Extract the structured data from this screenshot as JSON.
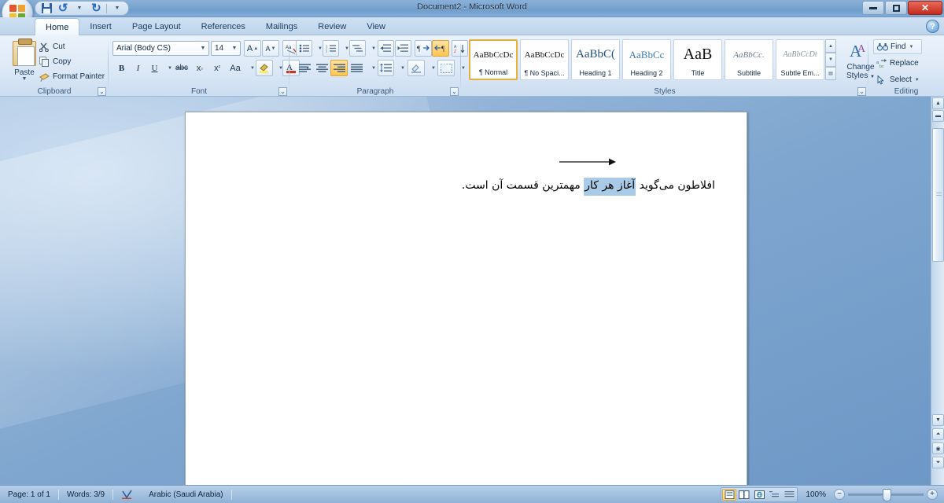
{
  "window": {
    "title": "Document2 - Microsoft Word",
    "minimize_label": "Minimize",
    "restore_label": "Restore",
    "close_label": "Close",
    "help_label": "?"
  },
  "quick_access": {
    "office_button": "office-button",
    "items": [
      {
        "name": "save-button",
        "icon": "save-icon",
        "label": "Save"
      },
      {
        "name": "undo-button",
        "icon": "undo-icon",
        "label": "Undo"
      },
      {
        "name": "redo-button",
        "icon": "redo-icon",
        "label": "Redo"
      },
      {
        "name": "customize-qat-button",
        "icon": "chevron-down-icon",
        "label": "Customize Quick Access Toolbar"
      }
    ]
  },
  "ribbon": {
    "tabs": [
      {
        "label": "Home",
        "active": true
      },
      {
        "label": "Insert",
        "active": false
      },
      {
        "label": "Page Layout",
        "active": false
      },
      {
        "label": "References",
        "active": false
      },
      {
        "label": "Mailings",
        "active": false
      },
      {
        "label": "Review",
        "active": false
      },
      {
        "label": "View",
        "active": false
      }
    ],
    "groups": {
      "clipboard": {
        "label": "Clipboard",
        "paste": "Paste",
        "items": [
          {
            "label": "Cut",
            "icon": "scissors-icon"
          },
          {
            "label": "Copy",
            "icon": "copy-icon"
          },
          {
            "label": "Format Painter",
            "icon": "format-painter-icon"
          }
        ]
      },
      "font": {
        "label": "Font",
        "font_name": "Arial (Body CS)",
        "font_size": "14",
        "buttons": [
          {
            "name": "grow-font-button",
            "cap": "A"
          },
          {
            "name": "shrink-font-button",
            "cap": "A"
          },
          {
            "name": "clear-formatting-button",
            "cap": "Aa"
          },
          {
            "name": "bold-button",
            "cap": "B"
          },
          {
            "name": "italic-button",
            "cap": "I"
          },
          {
            "name": "underline-button",
            "cap": "U"
          },
          {
            "name": "strikethrough-button",
            "cap": "abc"
          },
          {
            "name": "subscript-button",
            "cap": "x"
          },
          {
            "name": "superscript-button",
            "cap": "x"
          },
          {
            "name": "change-case-button",
            "cap": "Aa"
          },
          {
            "name": "text-highlight-color-button",
            "cap": "ab"
          },
          {
            "name": "font-color-button",
            "cap": "A"
          }
        ]
      },
      "paragraph": {
        "label": "Paragraph",
        "buttons": [
          {
            "name": "bullets-button",
            "cap": "bullet-list-icon"
          },
          {
            "name": "numbering-button",
            "cap": "numbered-list-icon"
          },
          {
            "name": "multilevel-list-button",
            "cap": "multilevel-list-icon"
          },
          {
            "name": "decrease-indent-button",
            "cap": "decrease-indent-icon"
          },
          {
            "name": "increase-indent-button",
            "cap": "increase-indent-icon"
          },
          {
            "name": "ltr-text-direction-button",
            "cap": "ltr-icon"
          },
          {
            "name": "rtl-text-direction-button",
            "cap": "rtl-icon",
            "active": true
          },
          {
            "name": "sort-button",
            "cap": "sort-icon"
          },
          {
            "name": "show-formatting-marks-button",
            "cap": "pilcrow-icon"
          },
          {
            "name": "align-left-button",
            "cap": "align-left-icon"
          },
          {
            "name": "align-center-button",
            "cap": "align-center-icon"
          },
          {
            "name": "align-right-button",
            "cap": "align-right-icon",
            "active": true
          },
          {
            "name": "justify-button",
            "cap": "justify-icon"
          },
          {
            "name": "line-spacing-button",
            "cap": "line-spacing-icon"
          },
          {
            "name": "shading-button",
            "cap": "shading-icon"
          },
          {
            "name": "borders-button",
            "cap": "borders-icon"
          }
        ]
      },
      "styles": {
        "label": "Styles",
        "change_styles_line1": "Change",
        "change_styles_line2": "Styles",
        "gallery": [
          {
            "preview": "AaBbCcDc",
            "name": "¶ Normal",
            "selected": true,
            "style": "normal"
          },
          {
            "preview": "AaBbCcDc",
            "name": "¶ No Spaci...",
            "selected": false,
            "style": "normal"
          },
          {
            "preview": "AaBbC(",
            "name": "Heading 1",
            "selected": false,
            "style": "h1"
          },
          {
            "preview": "AaBbCc",
            "name": "Heading 2",
            "selected": false,
            "style": "h2"
          },
          {
            "preview": "AaB",
            "name": "Title",
            "selected": false,
            "style": "title"
          },
          {
            "preview": "AaBbCc.",
            "name": "Subtitle",
            "selected": false,
            "style": "subtitle"
          },
          {
            "preview": "AaBbCcDt",
            "name": "Subtle Em...",
            "selected": false,
            "style": "subtle"
          }
        ]
      },
      "editing": {
        "label": "Editing",
        "items": [
          {
            "label": "Find",
            "icon": "binoculars-icon",
            "has_caret": true
          },
          {
            "label": "Replace",
            "icon": "replace-icon",
            "has_caret": false
          },
          {
            "label": "Select",
            "icon": "cursor-icon",
            "has_caret": true
          }
        ]
      }
    }
  },
  "document": {
    "text_before": "افلاطون می‌گوید ",
    "text_selected": "آغاز هر کار",
    "text_after": " مهمترین قسمت آن است.",
    "selection_color": "#a9cbe8",
    "annotation": "arrow-pointing-right"
  },
  "status_bar": {
    "page": "Page: 1 of 1",
    "words": "Words: 3/9",
    "proofing_icon": "proofing-errors-icon",
    "language": "Arabic (Saudi Arabia)",
    "zoom": "100%",
    "zoom_out_label": "−",
    "zoom_in_label": "+",
    "views": [
      {
        "name": "print-layout-view-button",
        "icon": "print-layout-icon",
        "active": true
      },
      {
        "name": "full-screen-reading-view-button",
        "icon": "reading-view-icon",
        "active": false
      },
      {
        "name": "web-layout-view-button",
        "icon": "web-layout-icon",
        "active": false
      },
      {
        "name": "outline-view-button",
        "icon": "outline-view-icon",
        "active": false
      },
      {
        "name": "draft-view-button",
        "icon": "draft-view-icon",
        "active": false
      }
    ]
  },
  "scrollbar": {
    "up_label": "▲",
    "down_label": "▼",
    "previous_page_label": "▲",
    "select_browse_object_label": "◉",
    "next_page_label": "▼"
  }
}
